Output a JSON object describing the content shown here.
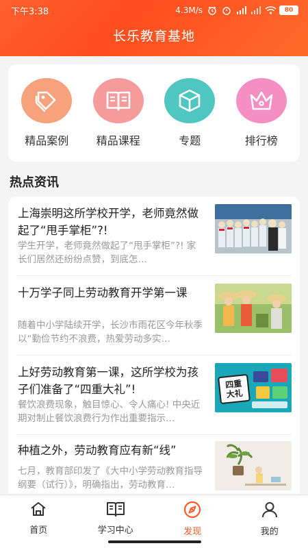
{
  "status_bar": {
    "time": "下午3:38",
    "network_speed": "4.3M/s",
    "battery": "80"
  },
  "app": {
    "title": "长乐教育基地"
  },
  "quick_links": [
    {
      "label": "精品案例",
      "icon": "tag-icon",
      "color": "#f6a27d"
    },
    {
      "label": "精品课程",
      "icon": "book-icon",
      "color": "#f59b9b"
    },
    {
      "label": "专题",
      "icon": "box-icon",
      "color": "#4fc7c0"
    },
    {
      "label": "排行榜",
      "icon": "crown-icon",
      "color": "#f58fc3"
    }
  ],
  "hot_news": {
    "title": "热点资讯",
    "items": [
      {
        "title": "上海崇明这所学校开学，老师竟然做起了“甩手掌柜”?!",
        "summary": "学生开学，老师竟然做起了“甩手掌柜”?! 家长们居然还纷纷点赞，到底怎…"
      },
      {
        "title": "十万学子同上劳动教育开学第一课",
        "summary": "随着中小学陆续开学，长沙市雨花区今年秋季以“勤俭节约不浪费，热爱劳动多实…"
      },
      {
        "title": "上好劳动教育第一课，这所学校为孩子们准备了“四重大礼”!",
        "summary": "餐饮浪费现象，触目惊心、令人痛心! 中央近期对制止餐饮浪费行为作出重要指示…",
        "thumb_text": "四重大礼"
      },
      {
        "title": "种植之外，劳动教育应有新“线”",
        "summary": "七月，教育部印发了《大中小学劳动教育指导纲要（试行）》，明确指出，劳动教育…"
      }
    ]
  },
  "tabbar": {
    "tabs": [
      {
        "label": "首页",
        "icon": "home-icon"
      },
      {
        "label": "学习中心",
        "icon": "open-book-icon"
      },
      {
        "label": "发现",
        "icon": "compass-icon",
        "active": true
      },
      {
        "label": "我的",
        "icon": "user-icon"
      }
    ],
    "active_color": "#ff5a26"
  }
}
